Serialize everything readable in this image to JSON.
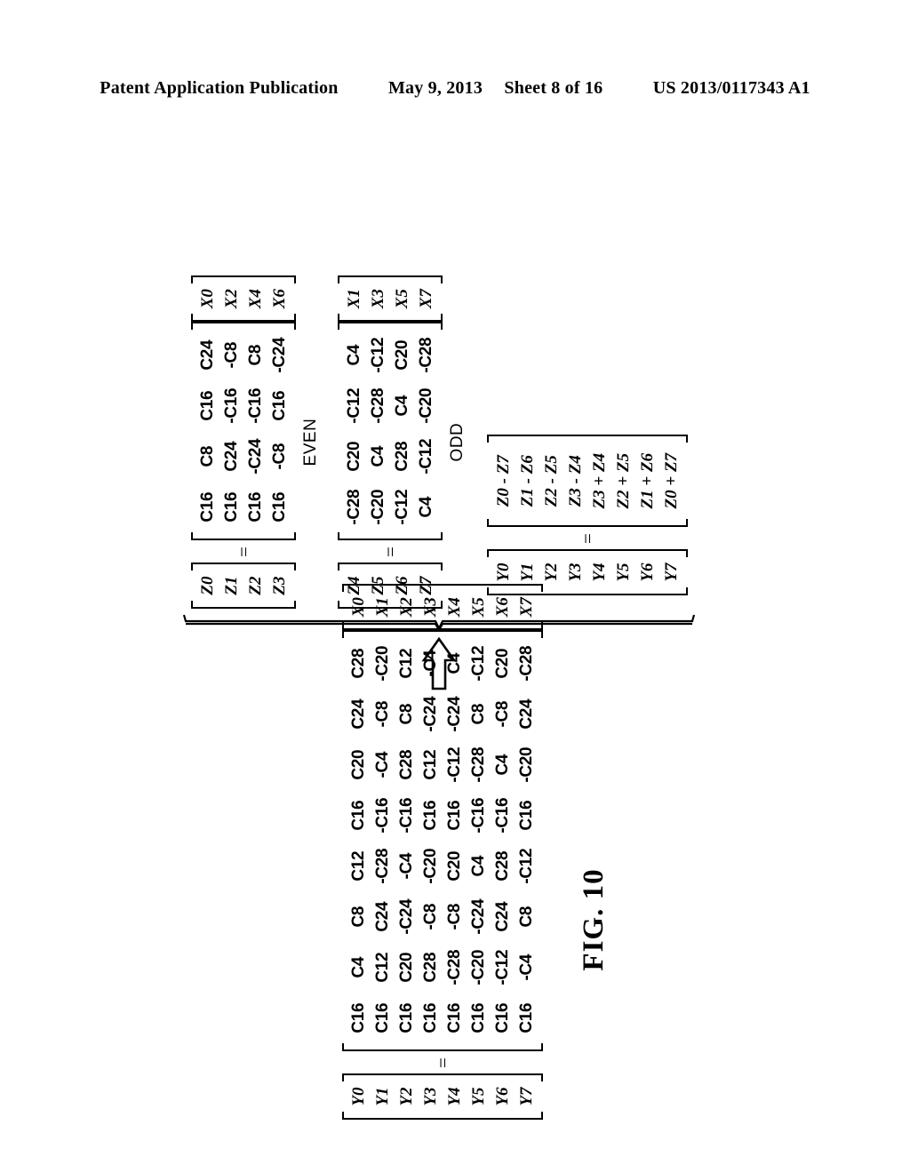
{
  "header": {
    "publication": "Patent Application Publication",
    "date": "May 9, 2013",
    "sheet": "Sheet 8 of 16",
    "patent_number": "US 2013/0117343 A1"
  },
  "figure": {
    "caption": "FIG. 10",
    "arrow": "up-arrow",
    "brace": "horizontal-brace"
  },
  "full_transform": {
    "label": "",
    "lhs_vector": [
      "Y0",
      "Y1",
      "Y2",
      "Y3",
      "Y4",
      "Y5",
      "Y6",
      "Y7"
    ],
    "equals": "=",
    "matrix": [
      [
        "C16",
        "C4",
        "C8",
        "C12",
        "C16",
        "C20",
        "C24",
        "C28"
      ],
      [
        "C16",
        "C12",
        "C24",
        "-C28",
        "-C16",
        "-C4",
        "-C8",
        "-C20"
      ],
      [
        "C16",
        "C20",
        "-C24",
        "-C4",
        "-C16",
        "C28",
        "C8",
        "C12"
      ],
      [
        "C16",
        "C28",
        "-C8",
        "-C20",
        "C16",
        "C12",
        "-C24",
        "-C4"
      ],
      [
        "C16",
        "-C28",
        "-C8",
        "C20",
        "C16",
        "-C12",
        "-C24",
        "C4"
      ],
      [
        "C16",
        "-C20",
        "-C24",
        "C4",
        "-C16",
        "-C28",
        "C8",
        "-C12"
      ],
      [
        "C16",
        "-C12",
        "C24",
        "C28",
        "-C16",
        "C4",
        "-C8",
        "C20"
      ],
      [
        "C16",
        "-C4",
        "C8",
        "-C12",
        "C16",
        "-C20",
        "C24",
        "-C28"
      ]
    ],
    "rhs_vector": [
      "X0",
      "X1",
      "X2",
      "X3",
      "X4",
      "X5",
      "X6",
      "X7"
    ]
  },
  "even_transform": {
    "label": "EVEN",
    "lhs_vector": [
      "Z0",
      "Z1",
      "Z2",
      "Z3"
    ],
    "equals": "=",
    "matrix": [
      [
        "C16",
        "C8",
        "C16",
        "C24"
      ],
      [
        "C16",
        "C24",
        "-C16",
        "-C8"
      ],
      [
        "C16",
        "-C24",
        "-C16",
        "C8"
      ],
      [
        "C16",
        "-C8",
        "C16",
        "-C24"
      ]
    ],
    "rhs_vector": [
      "X0",
      "X2",
      "X4",
      "X6"
    ]
  },
  "odd_transform": {
    "label": "ODD",
    "lhs_vector": [
      "Z4",
      "Z5",
      "Z6",
      "Z7"
    ],
    "equals": "=",
    "matrix": [
      [
        "-C28",
        "C20",
        "-C12",
        "C4"
      ],
      [
        "-C20",
        "C4",
        "-C28",
        "-C12"
      ],
      [
        "-C12",
        "C28",
        "C4",
        "C20"
      ],
      [
        "C4",
        "-C12",
        "-C20",
        "-C28"
      ]
    ],
    "rhs_vector": [
      "X1",
      "X3",
      "X5",
      "X7"
    ]
  },
  "combine": {
    "lhs_vector": [
      "Y0",
      "Y1",
      "Y2",
      "Y3",
      "Y4",
      "Y5",
      "Y6",
      "Y7"
    ],
    "equals": "=",
    "rhs_vector": [
      "Z0 - Z7",
      "Z1 - Z6",
      "Z2 - Z5",
      "Z3 - Z4",
      "Z3 + Z4",
      "Z2 + Z5",
      "Z1 + Z6",
      "Z0 + Z7"
    ]
  }
}
